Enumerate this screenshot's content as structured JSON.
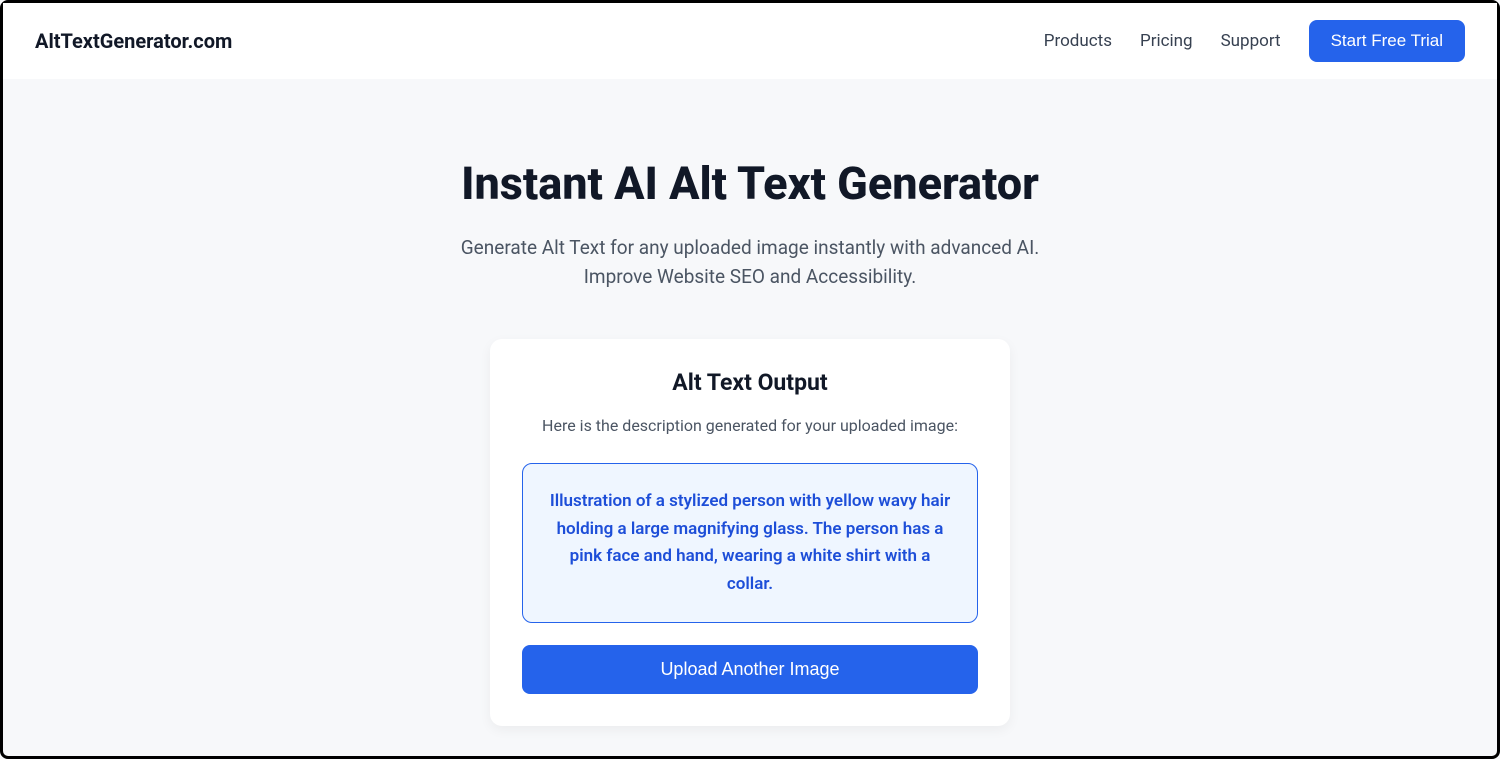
{
  "header": {
    "logo": "AltTextGenerator.com",
    "nav": {
      "products": "Products",
      "pricing": "Pricing",
      "support": "Support"
    },
    "cta": "Start Free Trial"
  },
  "hero": {
    "title": "Instant AI Alt Text Generator",
    "subtitle": "Generate Alt Text for any uploaded image instantly with advanced AI. Improve Website SEO and Accessibility."
  },
  "card": {
    "title": "Alt Text Output",
    "subtitle": "Here is the description generated for your uploaded image:",
    "output": "Illustration of a stylized person with yellow wavy hair holding a large magnifying glass. The person has a pink face and hand, wearing a white shirt with a collar.",
    "uploadButton": "Upload Another Image"
  }
}
